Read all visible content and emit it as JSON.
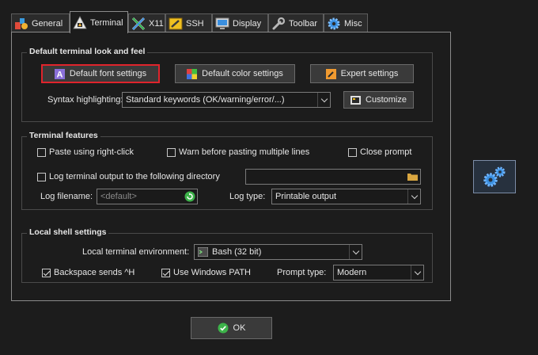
{
  "tabs": [
    {
      "label": "General",
      "icon": "general-tab-icon"
    },
    {
      "label": "Terminal",
      "icon": "terminal-tab-icon"
    },
    {
      "label": "X11",
      "icon": "x11-tab-icon"
    },
    {
      "label": "SSH",
      "icon": "ssh-tab-icon"
    },
    {
      "label": "Display",
      "icon": "display-tab-icon"
    },
    {
      "label": "Toolbar",
      "icon": "wrench-icon"
    },
    {
      "label": "Misc",
      "icon": "gear-icon"
    }
  ],
  "active_tab": "Terminal",
  "look_and_feel": {
    "title": "Default terminal look and feel",
    "font_button": "Default font settings",
    "color_button": "Default color settings",
    "expert_button": "Expert settings",
    "syntax_label": "Syntax highlighting:",
    "syntax_value": "Standard keywords (OK/warning/error/...)",
    "customize_button": "Customize"
  },
  "features": {
    "title": "Terminal features",
    "paste_right_click": {
      "label": "Paste using right-click",
      "checked": false
    },
    "warn_multiline": {
      "label": "Warn before pasting multiple lines",
      "checked": false
    },
    "close_prompt": {
      "label": "Close prompt",
      "checked": false
    },
    "log_output": {
      "label": "Log terminal output to the following directory",
      "checked": false
    },
    "log_filename_label": "Log filename:",
    "log_filename_value": "<default>",
    "log_type_label": "Log type:",
    "log_type_value": "Printable output"
  },
  "local_shell": {
    "title": "Local shell settings",
    "env_label": "Local terminal environment:",
    "env_value": "Bash (32 bit)",
    "backspace": {
      "label": "Backspace sends ^H",
      "checked": true
    },
    "windows_path": {
      "label": "Use Windows PATH",
      "checked": true
    },
    "prompt_type_label": "Prompt type:",
    "prompt_type_value": "Modern"
  },
  "ok_button": "OK",
  "colors": {
    "highlight_border": "#e0242c",
    "ok_green": "#3db34a",
    "gear_blue": "#3a8fe0"
  }
}
